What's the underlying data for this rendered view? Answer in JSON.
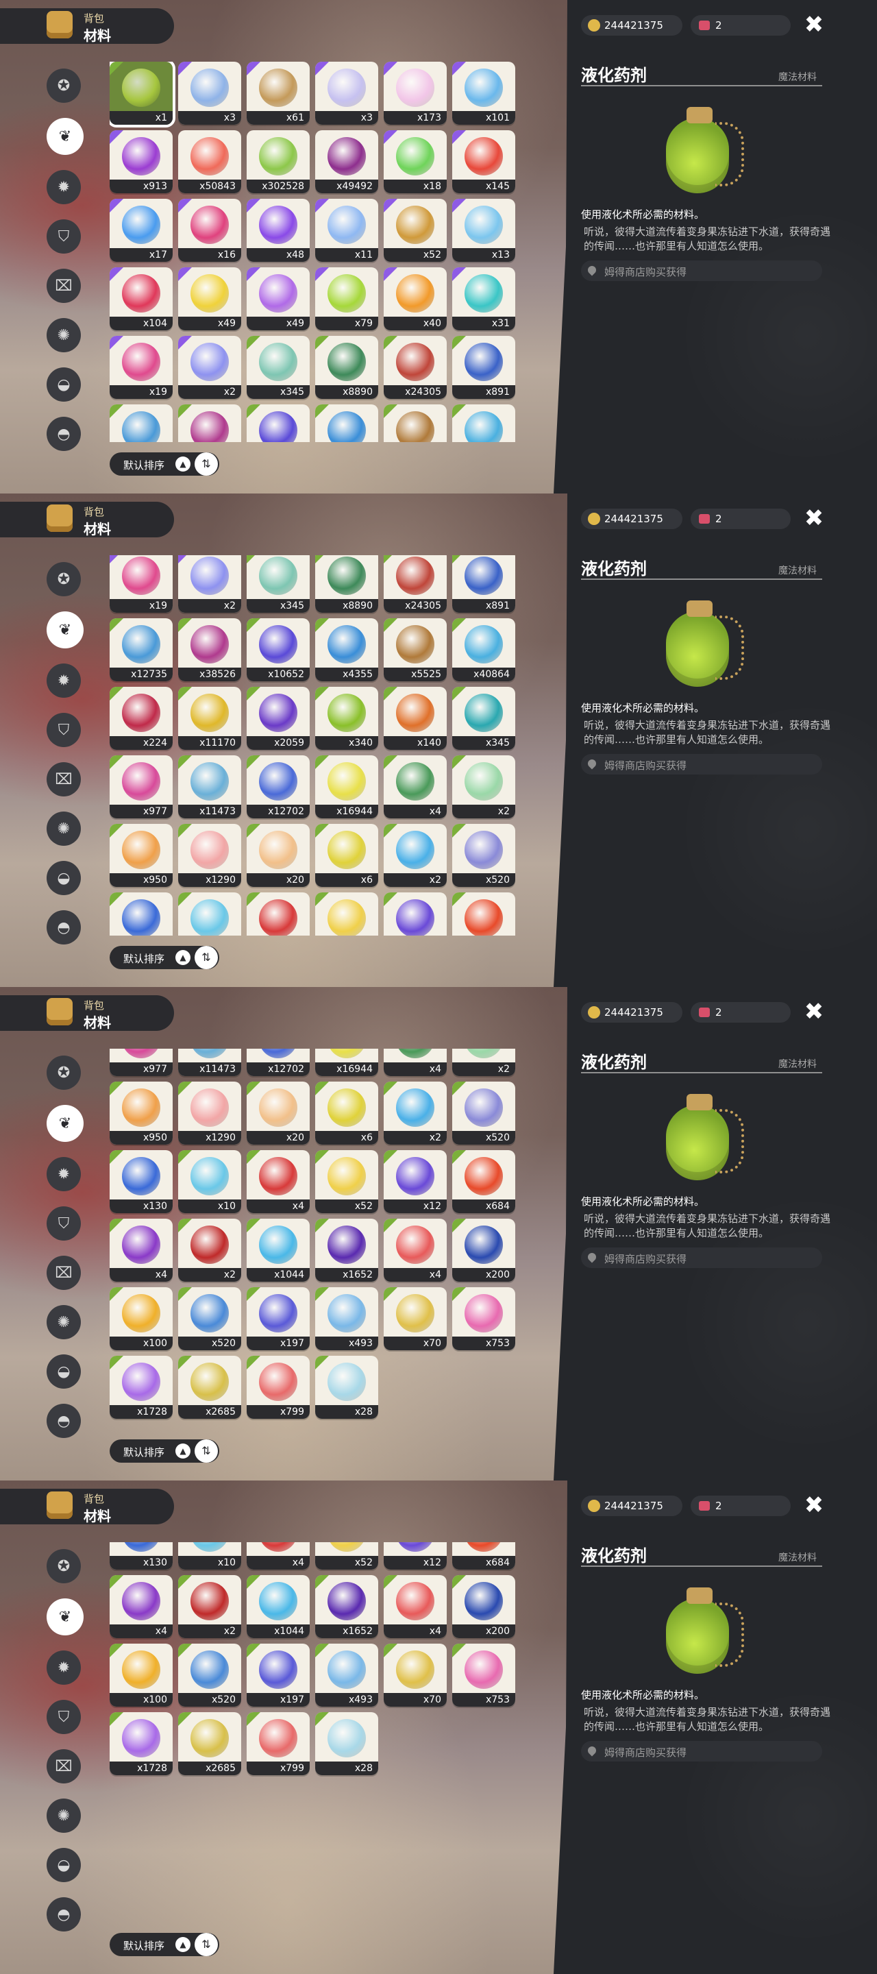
{
  "header": {
    "line1": "背包",
    "line2": "材料"
  },
  "currency": {
    "coins": "244421375",
    "tickets": "2"
  },
  "item_detail": {
    "name": "液化药剂",
    "category": "魔法材料",
    "description": "使用液化术所必需的材料。",
    "flavor": "听说，彼得大道流传着变身果冻钻进下水道，获得奇遇的传闻……也许那里有人知道怎么使用。",
    "source": "姆得商店购买获得"
  },
  "sort": {
    "label": "默认排序"
  },
  "icons": {
    "close": "close-icon",
    "coin": "coin-icon",
    "ticket": "ticket-icon",
    "sort_toggle": "sort-toggle-icon",
    "categories": [
      "star-badge-icon",
      "leaf-icon",
      "sun-badge-icon",
      "shield-icon",
      "gift-icon",
      "gear-badge-icon",
      "bag-icon",
      "pouch-icon"
    ]
  },
  "colors": {
    "selected_bg": "#6d8a3a",
    "rarity_purple": "#8e5be6",
    "rarity_green": "#7bb03a"
  },
  "inventory": [
    {
      "qty": "x1",
      "color": "#a6c63e",
      "corner": "g"
    },
    {
      "qty": "x3",
      "color": "#8fb3e8",
      "corner": "p"
    },
    {
      "qty": "x61",
      "color": "#c49a5a",
      "corner": "p"
    },
    {
      "qty": "x3",
      "color": "#c6c1f0",
      "corner": "p"
    },
    {
      "qty": "x173",
      "color": "#f2c6e8",
      "corner": "p"
    },
    {
      "qty": "x101",
      "color": "#6ab8ec",
      "corner": "p"
    },
    {
      "qty": "x913",
      "color": "#9b3dd2",
      "corner": "p"
    },
    {
      "qty": "x50843",
      "color": "#f06a5a",
      "corner": ""
    },
    {
      "qty": "x302528",
      "color": "#8dc84a",
      "corner": ""
    },
    {
      "qty": "x49492",
      "color": "#8e2e8e",
      "corner": ""
    },
    {
      "qty": "x18",
      "color": "#6fd45a",
      "corner": "p"
    },
    {
      "qty": "x145",
      "color": "#e8483a",
      "corner": "p"
    },
    {
      "qty": "x17",
      "color": "#4a9cef",
      "corner": "p"
    },
    {
      "qty": "x16",
      "color": "#e0427e",
      "corner": "p"
    },
    {
      "qty": "x48",
      "color": "#8a4ae8",
      "corner": "p"
    },
    {
      "qty": "x11",
      "color": "#8fb8f2",
      "corner": "p"
    },
    {
      "qty": "x52",
      "color": "#d09a3a",
      "corner": "p"
    },
    {
      "qty": "x13",
      "color": "#7cc6ee",
      "corner": "p"
    },
    {
      "qty": "x104",
      "color": "#e0385a",
      "corner": "p"
    },
    {
      "qty": "x49",
      "color": "#f0d23a",
      "corner": "p"
    },
    {
      "qty": "x49",
      "color": "#b06ae8",
      "corner": "p"
    },
    {
      "qty": "x79",
      "color": "#a6d83a",
      "corner": "p"
    },
    {
      "qty": "x40",
      "color": "#f29a2a",
      "corner": "p"
    },
    {
      "qty": "x31",
      "color": "#3ac6c6",
      "corner": "p"
    },
    {
      "qty": "x19",
      "color": "#e04a8e",
      "corner": "p"
    },
    {
      "qty": "x2",
      "color": "#8e92f0",
      "corner": "p"
    },
    {
      "qty": "x345",
      "color": "#7ec6b2",
      "corner": "g"
    },
    {
      "qty": "x8890",
      "color": "#3e8a5a",
      "corner": "g"
    },
    {
      "qty": "x24305",
      "color": "#c0463a",
      "corner": "g"
    },
    {
      "qty": "x891",
      "color": "#3a62c8",
      "corner": "g"
    },
    {
      "qty": "x12735",
      "color": "#4a9ad8",
      "corner": "g"
    },
    {
      "qty": "x38526",
      "color": "#b03a8e",
      "corner": "g"
    },
    {
      "qty": "x10652",
      "color": "#5a4ad8",
      "corner": "g"
    },
    {
      "qty": "x4355",
      "color": "#3a8ed8",
      "corner": "g"
    },
    {
      "qty": "x5525",
      "color": "#b07a3a",
      "corner": "g"
    },
    {
      "qty": "x40864",
      "color": "#4ab0e0",
      "corner": "g"
    },
    {
      "qty": "x224",
      "color": "#c02a4a",
      "corner": "g"
    },
    {
      "qty": "x11170",
      "color": "#e0b82a",
      "corner": "g"
    },
    {
      "qty": "x2059",
      "color": "#6a3ac8",
      "corner": "g"
    },
    {
      "qty": "x340",
      "color": "#8ac02a",
      "corner": "g"
    },
    {
      "qty": "x140",
      "color": "#e0702a",
      "corner": "g"
    },
    {
      "qty": "x345",
      "color": "#2aa8b0",
      "corner": "g"
    },
    {
      "qty": "x977",
      "color": "#d84a9a",
      "corner": "g"
    },
    {
      "qty": "x11473",
      "color": "#6ab0d8",
      "corner": "g"
    },
    {
      "qty": "x12702",
      "color": "#4a6ad8",
      "corner": "g"
    },
    {
      "qty": "x16944",
      "color": "#e8e04a",
      "corner": "g"
    },
    {
      "qty": "x4",
      "color": "#4a9a5a",
      "corner": "g"
    },
    {
      "qty": "x2",
      "color": "#9ad8a8",
      "corner": "g"
    },
    {
      "qty": "x950",
      "color": "#f0a04a",
      "corner": "g"
    },
    {
      "qty": "x1290",
      "color": "#f2a6a6",
      "corner": "g"
    },
    {
      "qty": "x20",
      "color": "#f2c08a",
      "corner": "g"
    },
    {
      "qty": "x6",
      "color": "#e0d23a",
      "corner": "g"
    },
    {
      "qty": "x2",
      "color": "#4ab0e8",
      "corner": "g"
    },
    {
      "qty": "x520",
      "color": "#8a8ad8",
      "corner": "g"
    },
    {
      "qty": "x130",
      "color": "#3a6ad8",
      "corner": "g"
    },
    {
      "qty": "x10",
      "color": "#6ac8e8",
      "corner": "g"
    },
    {
      "qty": "x4",
      "color": "#d83a3a",
      "corner": "g"
    },
    {
      "qty": "x52",
      "color": "#f0d04a",
      "corner": "g"
    },
    {
      "qty": "x12",
      "color": "#6a4ad8",
      "corner": "g"
    },
    {
      "qty": "x684",
      "color": "#e84a2a",
      "corner": "g"
    },
    {
      "qty": "x4",
      "color": "#8a3ac8",
      "corner": "g"
    },
    {
      "qty": "x2",
      "color": "#c02a2a",
      "corner": "g"
    },
    {
      "qty": "x1044",
      "color": "#4ab8e8",
      "corner": "g"
    },
    {
      "qty": "x1652",
      "color": "#5a2ab0",
      "corner": "g"
    },
    {
      "qty": "x4",
      "color": "#e85a5a",
      "corner": "g"
    },
    {
      "qty": "x200",
      "color": "#2a4ab0",
      "corner": "g"
    },
    {
      "qty": "x100",
      "color": "#f0b02a",
      "corner": "g"
    },
    {
      "qty": "x520",
      "color": "#4a8ad8",
      "corner": "g"
    },
    {
      "qty": "x197",
      "color": "#5a5ad8",
      "corner": "g"
    },
    {
      "qty": "x493",
      "color": "#7ab8e8",
      "corner": "g"
    },
    {
      "qty": "x70",
      "color": "#e0c04a",
      "corner": "g"
    },
    {
      "qty": "x753",
      "color": "#e86ab0",
      "corner": "g"
    },
    {
      "qty": "x1728",
      "color": "#a86ae8",
      "corner": "g"
    },
    {
      "qty": "x2685",
      "color": "#d8c04a",
      "corner": "g"
    },
    {
      "qty": "x799",
      "color": "#e86a6a",
      "corner": "g"
    },
    {
      "qty": "x28",
      "color": "#a8d8e8",
      "corner": "g"
    }
  ],
  "scroll_rows": [
    0,
    4,
    7,
    9
  ]
}
